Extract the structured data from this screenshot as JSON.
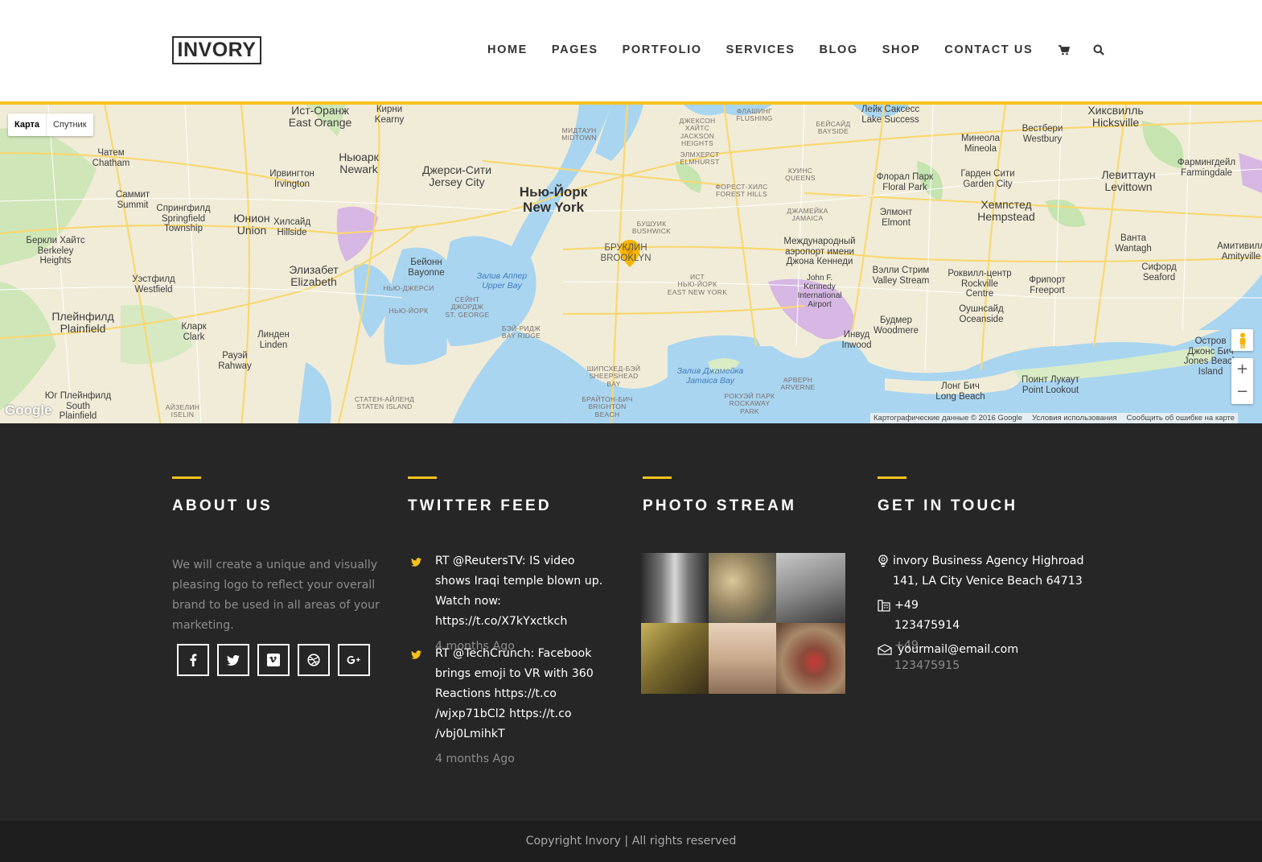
{
  "header": {
    "logo": "INVORY",
    "nav": [
      "HOME",
      "PAGES",
      "PORTFOLIO",
      "SERVICES",
      "BLOG",
      "SHOP",
      "CONTACT US"
    ],
    "icons": [
      "cart-icon",
      "search-icon"
    ]
  },
  "map": {
    "type_buttons": [
      "Карта",
      "Спутник"
    ],
    "labels": {
      "ist_orange": "Ист-Оранж\nEast Orange",
      "kirni": "Кирни\nKearny",
      "chatham": "Чатем\nChatham",
      "newark": "Ньюарк\nNewark",
      "irvington": "Ирвингтон\nIrvington",
      "jersey_city": "Джерси-Сити\nJersey City",
      "new_york": "Нью-Йорк\nNew York",
      "summit": "Саммит\nSummit",
      "springfield": "Спрингфилд\nSpringfield\nTownship",
      "union": "Юнион\nUnion",
      "hillside": "Хилсайд\nHillside",
      "berkeley": "Беркли Хайтс\nBerkeley\nHeights",
      "bayonne": "Бейонн\nBayonne",
      "elizabeth": "Элизабет\nElizabeth",
      "westfield": "Уэстфилд\nWestfield",
      "plainfield": "Плейнфилд\nPlainfield",
      "clark": "Кларк\nClark",
      "linden": "Линден\nLinden",
      "rahway": "Рауэй\nRahway",
      "south_plainfield": "Юг Плейнфилд\nSouth\nPlainfield",
      "brooklyn": "БРУКЛИН\nBROOKLYN",
      "queens": "КУИНС\nQUEENS",
      "jamaica": "ДЖАМЕЙКА\nJAMAICA",
      "floral_park": "Флорал Парк\nFloral Park",
      "garden_city": "Гарден Сити\nGarden City",
      "mineola": "Минеола\nMineola",
      "westbury": "Вестбери\nWestbury",
      "hicksville": "Хиксвилль\nHicksville",
      "levittown": "Левиттаун\nLevittown",
      "hempstead": "Хемпстед\nHempstead",
      "elmont": "Элмонт\nElmont",
      "jfk": "Международный\nаэропорт имени\nДжона Кеннеди",
      "jfk_en": "John F.\nKennedy\nInternational\nAirport",
      "valley_stream": "Вэлли Стрим\nValley Stream",
      "rockville": "Роквилл-центр\nRockville\nCentre",
      "freeport": "Фрипорт\nFreeport",
      "wantagh": "Ванта\nWantagh",
      "seaford": "Сифорд\nSeaford",
      "oceanside": "Оушнсайд\nOceanside",
      "woodmere": "Будмер\nWoodmere",
      "inwood": "Инвуд\nInwood",
      "long_beach": "Лонг Бич\nLong Beach",
      "point_lookout": "Поинт Лукаут\nPoint Lookout",
      "jones_beach": "Остров\nДжонс Бич\nJones Beach\nIsland",
      "amityville": "Амитивилл\nAmityville",
      "farmingdale": "Фармингдейл\nFarmingdale",
      "lake_success": "Лейк Саксесс\nLake Success",
      "flushing": "ФЛАШИНГ\nFLUSHING",
      "bayside": "БЕЙСАЙД\nBAYSIDE",
      "midtown": "МИДТАУН\nMIDTOWN",
      "jackson_heights": "ДЖЕКСОН\nХАЙТС\nJACKSON\nHEIGHTS",
      "elmhurst": "ЭЛМХЕРСТ\nELMHURST",
      "forest_hills": "ФОРЕСТ-ХИЛС\nFOREST HILLS",
      "bushwick": "БУШУИК\nBUSHWICK",
      "east_ny": "ИСТ\nНЬЮ-ЙОРК\nEAST NEW YORK",
      "st_george": "СЕЙНТ\nДЖОРДЖ\nST. GEORGE",
      "bay_ridge": "БЭЙ-РИДЖ\nBAY RIDGE",
      "sheepshead": "ШИПСХЕД-БЭЙ\nSHEEPSHEAD\nBAY",
      "brighton": "БРАЙТОН-БИЧ\nBRIGHTON\nBEACH",
      "rockaway": "РОКУЭЙ ПАРК\nROCKAWAY\nPARK",
      "arverne": "АРВЕРН\nARVERNE",
      "staten": "СТАТЕН-АЙЛЕНД\nSTATEN ISLAND",
      "iselin": "АЙЗЕЛИН\nISELIN",
      "nj_state": "НЬЮ-ДЖЕРСИ",
      "ny_state": "НЬЮ-ЙОРК",
      "upper_bay": "Залив Аппер\nUpper Bay",
      "jamaica_bay": "Залив Джамейка\nJamaica Bay"
    },
    "attribution": [
      "Картографические данные © 2016 Google",
      "Условия использования",
      "Сообщить об ошибке на карте"
    ],
    "logo": "Google"
  },
  "footer": {
    "about": {
      "title": "ABOUT US",
      "text": "We will create a unique and visually pleasing logo to reflect your overall brand to be used in all areas of your marketing.",
      "socials": [
        "facebook-icon",
        "twitter-icon",
        "vimeo-icon",
        "dribbble-icon",
        "google-plus-icon"
      ]
    },
    "twitter": {
      "title": "TWITTER FEED",
      "tweets": [
        {
          "text": "RT @ReutersTV: IS video shows Iraqi temple blown up. Watch now: https://t.co/X7kYxctkch",
          "time": "4 months Ago"
        },
        {
          "text": "RT @TechCrunch: Facebook brings emoji to VR with 360 Reactions https://t.co /wjxp71bCl2 https://t.co /vbj0LmihkT",
          "time": "4 months Ago"
        }
      ]
    },
    "photos": {
      "title": "PHOTO STREAM",
      "count": 6
    },
    "contact": {
      "title": "GET IN TOUCH",
      "address": "invory Business Agency Highroad 141, LA City Venice Beach 64713",
      "phone1": "+49 123475914",
      "phone2": "+49 123475915",
      "email": "yourmail@email.com"
    }
  },
  "copyright": "Copyright Invory | All rights reserved",
  "colors": {
    "accent": "#f7c21c",
    "footer_bg": "#262626",
    "copyright_bg": "#1e1e1e",
    "water": "#a9d5f0",
    "land": "#f1ecd8",
    "park": "#c5e4b0",
    "airport": "#d7b7e3"
  }
}
